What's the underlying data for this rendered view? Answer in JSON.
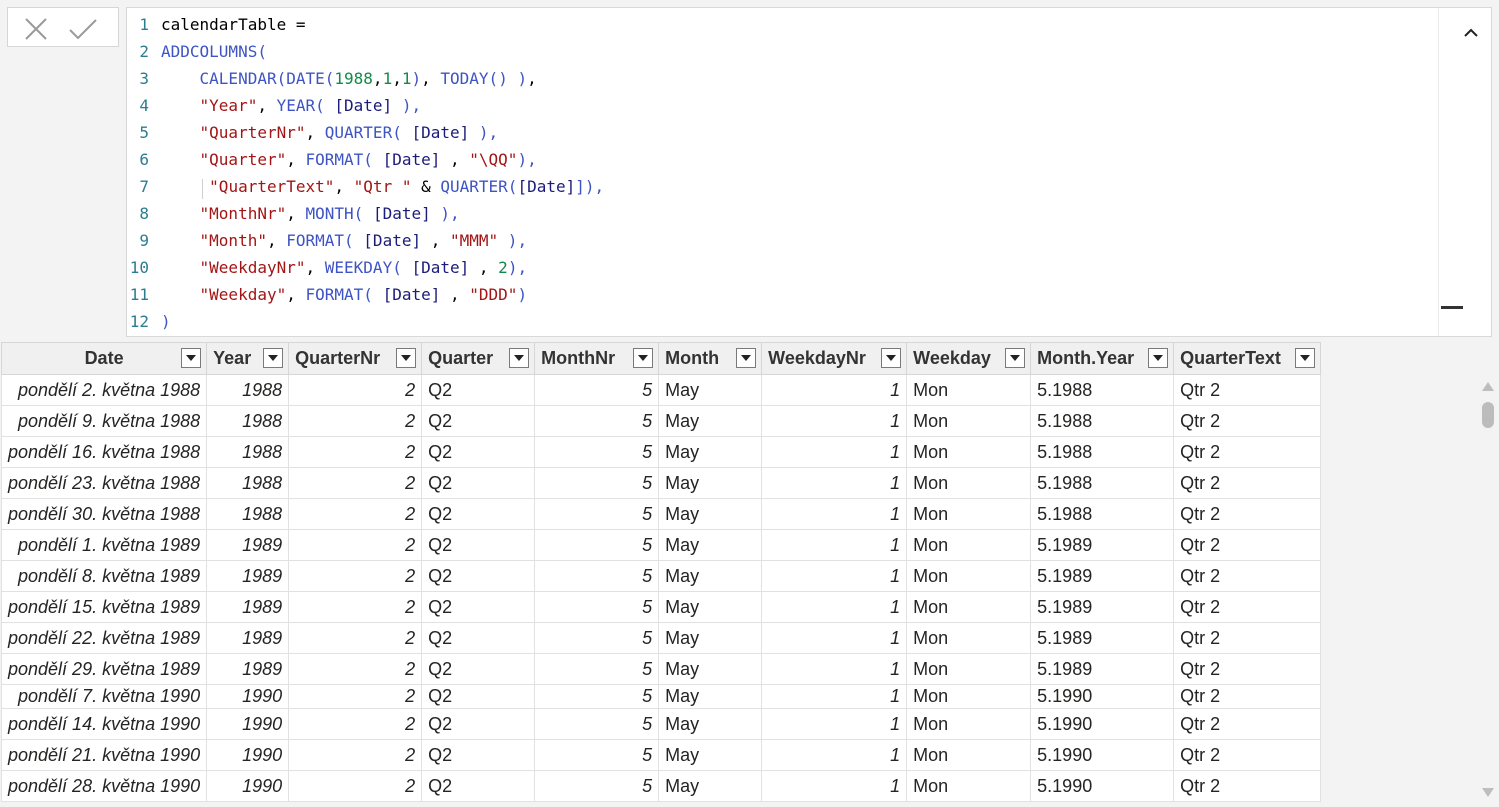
{
  "formula": {
    "commit_cancel_icon": "close-icon",
    "commit_confirm_icon": "checkmark-icon",
    "lines": [
      {
        "n": "1",
        "tokens": [
          {
            "t": "calendarTable =",
            "c": "pl"
          }
        ]
      },
      {
        "n": "2",
        "tokens": [
          {
            "t": "ADDCOLUMNS(",
            "c": "kw"
          }
        ]
      },
      {
        "n": "3",
        "tokens": [
          {
            "t": "    ",
            "c": "pl"
          },
          {
            "t": "CALENDAR(DATE(",
            "c": "kw"
          },
          {
            "t": "1988",
            "c": "nm"
          },
          {
            "t": ",",
            "c": "pl"
          },
          {
            "t": "1",
            "c": "nm"
          },
          {
            "t": ",",
            "c": "pl"
          },
          {
            "t": "1",
            "c": "nm"
          },
          {
            "t": ")",
            "c": "kw"
          },
          {
            "t": ", ",
            "c": "pl"
          },
          {
            "t": "TODAY() )",
            "c": "kw"
          },
          {
            "t": ",",
            "c": "pl"
          }
        ]
      },
      {
        "n": "4",
        "tokens": [
          {
            "t": "    ",
            "c": "pl"
          },
          {
            "t": "\"Year\"",
            "c": "st"
          },
          {
            "t": ", ",
            "c": "pl"
          },
          {
            "t": "YEAR( ",
            "c": "kw"
          },
          {
            "t": "[Date]",
            "c": "cl"
          },
          {
            "t": " ),",
            "c": "kw"
          }
        ]
      },
      {
        "n": "5",
        "tokens": [
          {
            "t": "    ",
            "c": "pl"
          },
          {
            "t": "\"QuarterNr\"",
            "c": "st"
          },
          {
            "t": ", ",
            "c": "pl"
          },
          {
            "t": "QUARTER( ",
            "c": "kw"
          },
          {
            "t": "[Date]",
            "c": "cl"
          },
          {
            "t": " ),",
            "c": "kw"
          }
        ]
      },
      {
        "n": "6",
        "tokens": [
          {
            "t": "    ",
            "c": "pl"
          },
          {
            "t": "\"Quarter\"",
            "c": "st"
          },
          {
            "t": ", ",
            "c": "pl"
          },
          {
            "t": "FORMAT( ",
            "c": "kw"
          },
          {
            "t": "[Date]",
            "c": "cl"
          },
          {
            "t": " , ",
            "c": "pl"
          },
          {
            "t": "\"\\QQ\"",
            "c": "st"
          },
          {
            "t": "),",
            "c": "kw"
          }
        ]
      },
      {
        "n": "7",
        "tokens": [
          {
            "t": "     ",
            "c": "pl"
          },
          {
            "t": "\"QuarterText\"",
            "c": "st"
          },
          {
            "t": ", ",
            "c": "pl"
          },
          {
            "t": "\"Qtr \"",
            "c": "st"
          },
          {
            "t": " & ",
            "c": "pl"
          },
          {
            "t": "QUARTER(",
            "c": "kw"
          },
          {
            "t": "[Date]",
            "c": "cl"
          },
          {
            "t": "]),",
            "c": "kw"
          }
        ]
      },
      {
        "n": "8",
        "tokens": [
          {
            "t": "    ",
            "c": "pl"
          },
          {
            "t": "\"MonthNr\"",
            "c": "st"
          },
          {
            "t": ", ",
            "c": "pl"
          },
          {
            "t": "MONTH( ",
            "c": "kw"
          },
          {
            "t": "[Date]",
            "c": "cl"
          },
          {
            "t": " ),",
            "c": "kw"
          }
        ]
      },
      {
        "n": "9",
        "tokens": [
          {
            "t": "    ",
            "c": "pl"
          },
          {
            "t": "\"Month\"",
            "c": "st"
          },
          {
            "t": ", ",
            "c": "pl"
          },
          {
            "t": "FORMAT( ",
            "c": "kw"
          },
          {
            "t": "[Date]",
            "c": "cl"
          },
          {
            "t": " , ",
            "c": "pl"
          },
          {
            "t": "\"MMM\"",
            "c": "st"
          },
          {
            "t": " ),",
            "c": "kw"
          }
        ]
      },
      {
        "n": "10",
        "tokens": [
          {
            "t": "    ",
            "c": "pl"
          },
          {
            "t": "\"WeekdayNr\"",
            "c": "st"
          },
          {
            "t": ", ",
            "c": "pl"
          },
          {
            "t": "WEEKDAY( ",
            "c": "kw"
          },
          {
            "t": "[Date]",
            "c": "cl"
          },
          {
            "t": " , ",
            "c": "pl"
          },
          {
            "t": "2",
            "c": "nm"
          },
          {
            "t": "),",
            "c": "kw"
          }
        ]
      },
      {
        "n": "11",
        "tokens": [
          {
            "t": "    ",
            "c": "pl"
          },
          {
            "t": "\"Weekday\"",
            "c": "st"
          },
          {
            "t": ", ",
            "c": "pl"
          },
          {
            "t": "FORMAT( ",
            "c": "kw"
          },
          {
            "t": "[Date]",
            "c": "cl"
          },
          {
            "t": " , ",
            "c": "pl"
          },
          {
            "t": "\"DDD\"",
            "c": "st"
          },
          {
            "t": ")",
            "c": "kw"
          }
        ]
      },
      {
        "n": "12",
        "tokens": [
          {
            "t": ")",
            "c": "kw"
          }
        ]
      }
    ]
  },
  "table": {
    "columns": [
      {
        "label": "Date",
        "align": "r"
      },
      {
        "label": "Year",
        "align": "r"
      },
      {
        "label": "QuarterNr",
        "align": "r"
      },
      {
        "label": "Quarter",
        "align": "l"
      },
      {
        "label": "MonthNr",
        "align": "r"
      },
      {
        "label": "Month",
        "align": "l"
      },
      {
        "label": "WeekdayNr",
        "align": "r"
      },
      {
        "label": "Weekday",
        "align": "l"
      },
      {
        "label": "Month.Year",
        "align": "l"
      },
      {
        "label": "QuarterText",
        "align": "l"
      }
    ],
    "rows": [
      [
        "pondělí 2. května 1988",
        "1988",
        "2",
        "Q2",
        "5",
        "May",
        "1",
        "Mon",
        "5.1988",
        "Qtr 2"
      ],
      [
        "pondělí 9. května 1988",
        "1988",
        "2",
        "Q2",
        "5",
        "May",
        "1",
        "Mon",
        "5.1988",
        "Qtr 2"
      ],
      [
        "pondělí 16. května 1988",
        "1988",
        "2",
        "Q2",
        "5",
        "May",
        "1",
        "Mon",
        "5.1988",
        "Qtr 2"
      ],
      [
        "pondělí 23. května 1988",
        "1988",
        "2",
        "Q2",
        "5",
        "May",
        "1",
        "Mon",
        "5.1988",
        "Qtr 2"
      ],
      [
        "pondělí 30. května 1988",
        "1988",
        "2",
        "Q2",
        "5",
        "May",
        "1",
        "Mon",
        "5.1988",
        "Qtr 2"
      ],
      [
        "pondělí 1. května 1989",
        "1989",
        "2",
        "Q2",
        "5",
        "May",
        "1",
        "Mon",
        "5.1989",
        "Qtr 2"
      ],
      [
        "pondělí 8. května 1989",
        "1989",
        "2",
        "Q2",
        "5",
        "May",
        "1",
        "Mon",
        "5.1989",
        "Qtr 2"
      ],
      [
        "pondělí 15. května 1989",
        "1989",
        "2",
        "Q2",
        "5",
        "May",
        "1",
        "Mon",
        "5.1989",
        "Qtr 2"
      ],
      [
        "pondělí 22. května 1989",
        "1989",
        "2",
        "Q2",
        "5",
        "May",
        "1",
        "Mon",
        "5.1989",
        "Qtr 2"
      ],
      [
        "pondělí 29. května 1989",
        "1989",
        "2",
        "Q2",
        "5",
        "May",
        "1",
        "Mon",
        "5.1989",
        "Qtr 2"
      ],
      [
        "pondělí 7. května 1990",
        "1990",
        "2",
        "Q2",
        "5",
        "May",
        "1",
        "Mon",
        "5.1990",
        "Qtr 2"
      ],
      [
        "pondělí 14. května 1990",
        "1990",
        "2",
        "Q2",
        "5",
        "May",
        "1",
        "Mon",
        "5.1990",
        "Qtr 2"
      ],
      [
        "pondělí 21. května 1990",
        "1990",
        "2",
        "Q2",
        "5",
        "May",
        "1",
        "Mon",
        "5.1990",
        "Qtr 2"
      ],
      [
        "pondělí 28. května 1990",
        "1990",
        "2",
        "Q2",
        "5",
        "May",
        "1",
        "Mon",
        "5.1990",
        "Qtr 2"
      ]
    ]
  },
  "colors": {
    "keyword": "#3e54c4",
    "string": "#a31515",
    "number": "#128a49",
    "column_ref": "#1b1b7a",
    "line_number": "#2b7d8f"
  }
}
